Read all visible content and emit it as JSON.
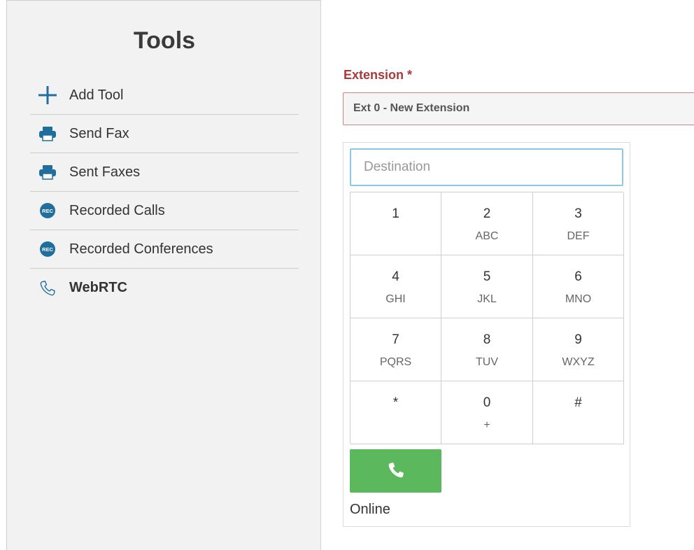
{
  "sidebar": {
    "title": "Tools",
    "items": [
      {
        "label": "Add Tool",
        "icon": "plus-icon"
      },
      {
        "label": "Send Fax",
        "icon": "printer-icon"
      },
      {
        "label": "Sent Faxes",
        "icon": "printer-icon"
      },
      {
        "label": "Recorded Calls",
        "icon": "rec-icon"
      },
      {
        "label": "Recorded Conferences",
        "icon": "rec-icon"
      },
      {
        "label": "WebRTC",
        "icon": "phone-icon",
        "active": true
      }
    ],
    "rec_badge": "REC"
  },
  "extension": {
    "label": "Extension *",
    "selected": "Ext 0 - New Extension"
  },
  "dialer": {
    "destination_placeholder": "Destination",
    "keys": [
      {
        "digit": "1",
        "letters": ""
      },
      {
        "digit": "2",
        "letters": "ABC"
      },
      {
        "digit": "3",
        "letters": "DEF"
      },
      {
        "digit": "4",
        "letters": "GHI"
      },
      {
        "digit": "5",
        "letters": "JKL"
      },
      {
        "digit": "6",
        "letters": "MNO"
      },
      {
        "digit": "7",
        "letters": "PQRS"
      },
      {
        "digit": "8",
        "letters": "TUV"
      },
      {
        "digit": "9",
        "letters": "WXYZ"
      },
      {
        "digit": "*",
        "letters": ""
      },
      {
        "digit": "0",
        "letters": "+"
      },
      {
        "digit": "#",
        "letters": ""
      }
    ],
    "status": "Online"
  },
  "colors": {
    "accent_blue": "#1f6e9e",
    "label_red": "#a83a3a",
    "call_green": "#5cb85c"
  }
}
